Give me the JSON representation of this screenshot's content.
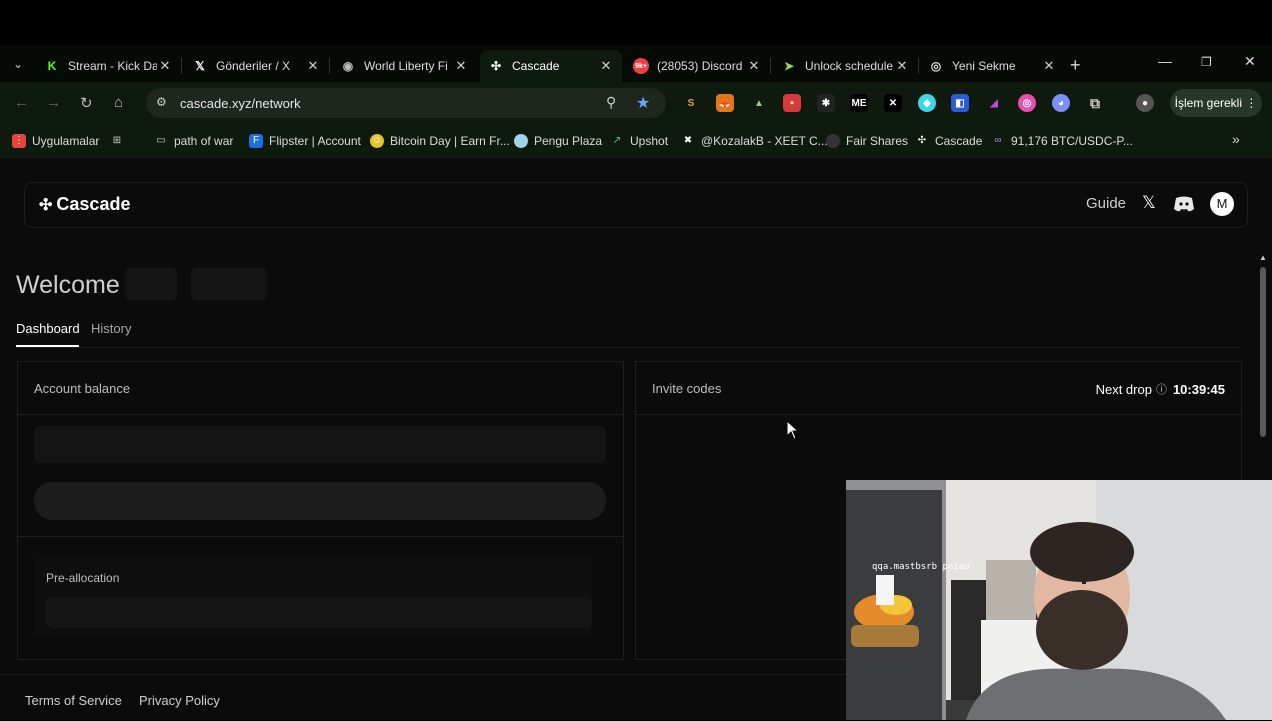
{
  "browser": {
    "tabs": [
      {
        "label": "Stream - Kick Da",
        "icon": "kick-icon",
        "color": "#53fc18",
        "glyph": "K"
      },
      {
        "label": "Gönderiler / X",
        "icon": "x-icon",
        "color": "#ffffff",
        "glyph": "X"
      },
      {
        "label": "World Liberty Fi",
        "icon": "wlfi-icon",
        "color": "#bbbbbb",
        "glyph": "◉"
      },
      {
        "label": "Cascade",
        "icon": "cascade-icon",
        "color": "#ffffff",
        "glyph": "✣"
      },
      {
        "label": "(28053) Discord",
        "icon": "discord-icon",
        "color": "#ed4245",
        "glyph": "9k+"
      },
      {
        "label": "Unlock schedule",
        "icon": "unlock-icon",
        "color": "#9ad06a",
        "glyph": "➤"
      },
      {
        "label": "Yeni Sekme",
        "icon": "chrome-icon",
        "color": "#dddddd",
        "glyph": "◎"
      }
    ],
    "url": "cascade.xyz/network",
    "update_button": "İşlem gerekli ⋮",
    "bookmarks": [
      {
        "label": "Uygulamalar",
        "icon": "apps-icon"
      },
      {
        "label": "path of war",
        "icon": "folder-icon"
      },
      {
        "label": "Flipster | Account",
        "icon": "flipster-icon"
      },
      {
        "label": "Bitcoin Day | Earn Fr...",
        "icon": "bitcoin-day-icon"
      },
      {
        "label": "Pengu Plaza",
        "icon": "pengu-icon"
      },
      {
        "label": "Upshot",
        "icon": "upshot-icon"
      },
      {
        "label": "@KozalakB - XEET C...",
        "icon": "xeet-icon"
      },
      {
        "label": "Fair Shares",
        "icon": "fairshares-icon"
      },
      {
        "label": "Cascade",
        "icon": "cascade-icon"
      },
      {
        "label": "91,176 BTC/USDC-P...",
        "icon": "btc-pair-icon"
      }
    ]
  },
  "app": {
    "logo_text": "Cascade",
    "nav": {
      "guide": "Guide",
      "avatar_letter": "M"
    },
    "welcome": "Welcome",
    "tabs": [
      "Dashboard",
      "History"
    ],
    "account_card": {
      "title": "Account balance",
      "preallocation": "Pre-allocation"
    },
    "invite_card": {
      "title": "Invite codes",
      "next_drop_label": "Next drop",
      "next_drop_time": "10:39:45"
    },
    "footer": {
      "terms": "Terms of Service",
      "privacy": "Privacy Policy"
    }
  },
  "webcam": {
    "overlay_text": "qqa.mastbsrb pniau"
  }
}
